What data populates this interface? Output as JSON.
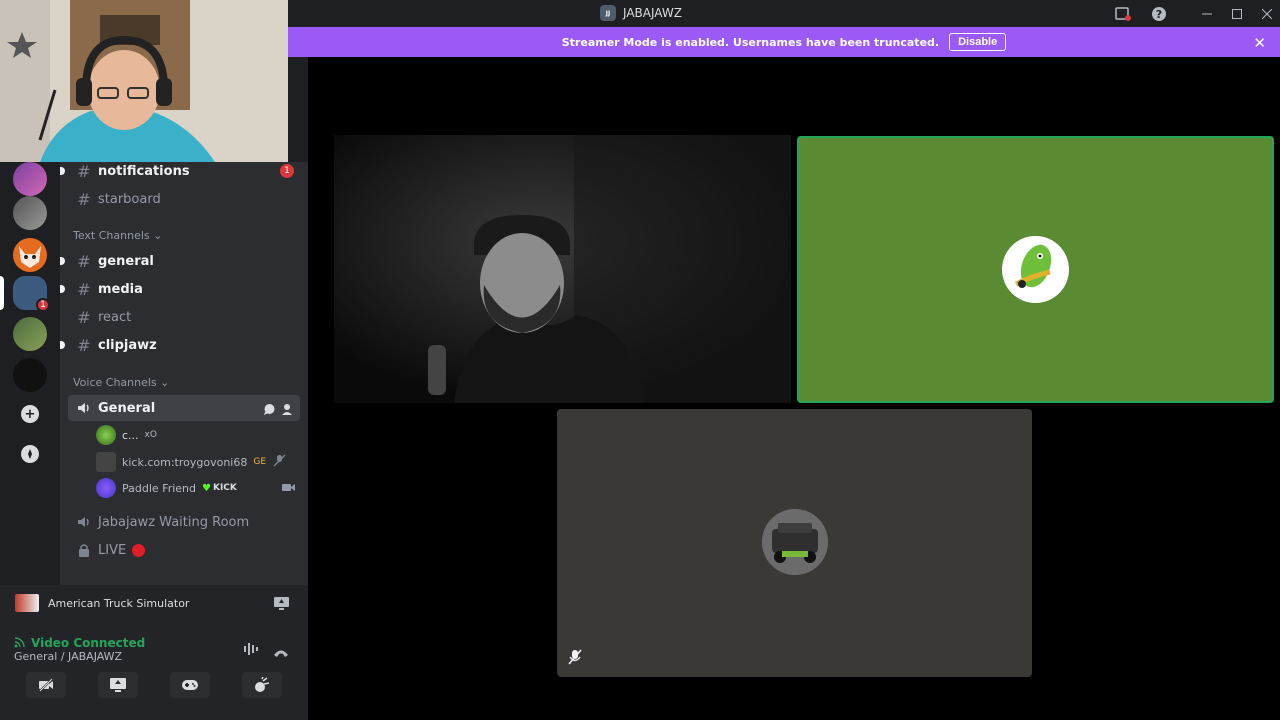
{
  "window": {
    "title": "JABAJAWZ",
    "server_mini_label": "JJ"
  },
  "banner": {
    "text": "Streamer Mode is enabled. Usernames have been truncated.",
    "button": "Disable"
  },
  "rail": {
    "badge": "1"
  },
  "channels": {
    "notifications": "notifications",
    "notifications_count": "1",
    "starboard": "starboard",
    "text_category": "Text Channels",
    "general": "general",
    "media": "media",
    "react": "react",
    "clipjawz": "clipjawz",
    "voice_category": "Voice Channels",
    "voice_general": "General",
    "waiting_room": "Jabajawz Waiting Room",
    "live": "LIVE"
  },
  "voice_users": [
    {
      "name": "c...",
      "tag": "xO"
    },
    {
      "name": "kick.com:troygovoni68",
      "tag": "GE"
    },
    {
      "name": "Paddle Friend",
      "tag": "KICK"
    }
  ],
  "activity": {
    "game": "American Truck Simulator"
  },
  "voice_panel": {
    "status": "Video Connected",
    "location": "General / JABAJAWZ"
  },
  "colors": {
    "accent": "#9b59f6",
    "connected": "#23a55a",
    "mention": "#da373c",
    "green_tile": "#5a8a32"
  },
  "icons": {
    "hash": "#",
    "speaker": "speaker-icon",
    "lock": "lock-icon",
    "close": "✕",
    "help": "?",
    "add": "+",
    "compass": "compass-icon"
  }
}
